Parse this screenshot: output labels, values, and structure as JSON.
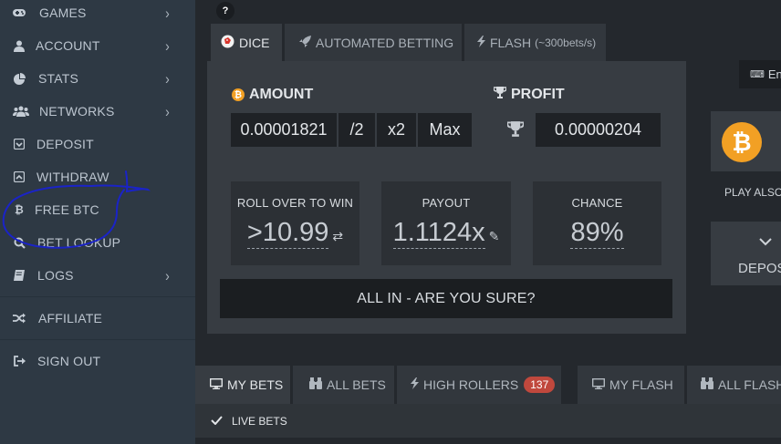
{
  "sidebar": {
    "items": [
      {
        "label": "GAMES",
        "icon": "gamepad-icon",
        "chevron": true
      },
      {
        "label": "ACCOUNT",
        "icon": "user-icon",
        "chevron": true
      },
      {
        "label": "STATS",
        "icon": "pie-chart-icon",
        "chevron": true
      },
      {
        "label": "NETWORKS",
        "icon": "users-icon",
        "chevron": true
      },
      {
        "label": "DEPOSIT",
        "icon": "deposit-icon",
        "chevron": false
      },
      {
        "label": "WITHDRAW",
        "icon": "withdraw-icon",
        "chevron": false
      },
      {
        "label": "FREE BTC",
        "icon": "bitcoin-icon",
        "chevron": false
      },
      {
        "label": "BET LOOKUP",
        "icon": "search-icon",
        "chevron": false
      },
      {
        "label": "LOGS",
        "icon": "book-icon",
        "chevron": true
      },
      {
        "label": "AFFILIATE",
        "icon": "shuffle-icon",
        "chevron": false
      },
      {
        "label": "SIGN OUT",
        "icon": "sign-out-icon",
        "chevron": false
      }
    ]
  },
  "help": "?",
  "tabs": {
    "dice": "DICE",
    "automated": "AUTOMATED BETTING",
    "flash": "FLASH",
    "flash_sub": "(~300bets/s)"
  },
  "amount": {
    "label": "AMOUNT",
    "value": "0.00001821",
    "half": "/2",
    "double": "x2",
    "max": "Max"
  },
  "profit": {
    "label": "PROFIT",
    "value": "0.00000204"
  },
  "stats": {
    "roll_caption": "ROLL OVER TO WIN",
    "roll_value": ">10.99",
    "payout_caption": "PAYOUT",
    "payout_value": "1.1124x",
    "chance_caption": "CHANCE",
    "chance_value": "89%"
  },
  "allin": "ALL IN - ARE YOU SURE?",
  "right": {
    "keyboard_label": "En",
    "play_also": "PLAY ALSO",
    "deposit": "DEPOS"
  },
  "bottom_tabs": {
    "my_bets": "MY BETS",
    "all_bets": "ALL BETS",
    "high_rollers": "HIGH ROLLERS",
    "high_rollers_count": "137",
    "my_flash": "MY FLASH",
    "all_flash": "ALL FLASH"
  },
  "live_bets": "LIVE BETS",
  "colors": {
    "sidebar_bg": "#2e3944",
    "panel_bg": "#373c42",
    "bitcoin": "#f2a024",
    "badge": "#c0483d",
    "annotation": "#1a23c8"
  }
}
